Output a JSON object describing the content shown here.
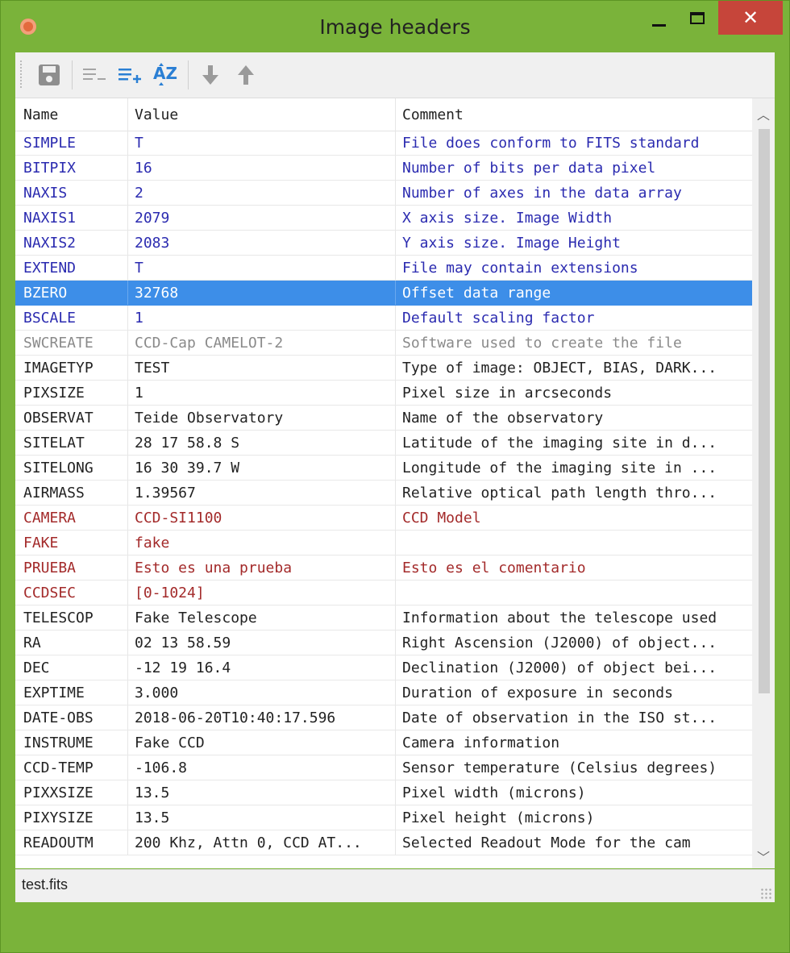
{
  "window": {
    "title": "Image headers",
    "close_glyph": "✕"
  },
  "toolbar": {
    "icons": [
      "save-icon",
      "remove-lines-icon",
      "add-lines-icon",
      "sort-az-icon",
      "arrow-down-icon",
      "arrow-up-icon"
    ],
    "colors": {
      "enabled": "#2a7fd4",
      "disabled": "#9a9a9a"
    }
  },
  "table": {
    "columns": [
      "Name",
      "Value",
      "Comment"
    ],
    "rows": [
      {
        "name": "SIMPLE",
        "value": "T",
        "comment": "File does conform to FITS standard",
        "color": "#2b2bb0"
      },
      {
        "name": "BITPIX",
        "value": "16",
        "comment": "Number of bits per data pixel",
        "color": "#2b2bb0"
      },
      {
        "name": "NAXIS",
        "value": "2",
        "comment": "Number of axes in the data array",
        "color": "#2b2bb0"
      },
      {
        "name": "NAXIS1",
        "value": "2079",
        "comment": "X axis size. Image Width",
        "color": "#2b2bb0"
      },
      {
        "name": "NAXIS2",
        "value": "2083",
        "comment": "Y axis size. Image Height",
        "color": "#2b2bb0"
      },
      {
        "name": "EXTEND",
        "value": "T",
        "comment": "File may contain extensions",
        "color": "#2b2bb0"
      },
      {
        "name": "BZERO",
        "value": "32768",
        "comment": "Offset data range",
        "color": "#ffffff",
        "selected": true
      },
      {
        "name": "BSCALE",
        "value": "1",
        "comment": "Default scaling factor",
        "color": "#2b2bb0"
      },
      {
        "name": "SWCREATE",
        "value": "CCD-Cap CAMELOT-2",
        "comment": "Software used to create the file",
        "color": "#8a8a8a"
      },
      {
        "name": "IMAGETYP",
        "value": "TEST",
        "comment": "Type of image: OBJECT, BIAS, DARK...",
        "color": "#222222"
      },
      {
        "name": "PIXSIZE",
        "value": "1",
        "comment": "Pixel size in arcseconds",
        "color": "#222222"
      },
      {
        "name": "OBSERVAT",
        "value": "Teide Observatory",
        "comment": "Name of the observatory",
        "color": "#222222"
      },
      {
        "name": "SITELAT",
        "value": "28 17 58.8 S",
        "comment": "Latitude of the imaging site in d...",
        "color": "#222222"
      },
      {
        "name": "SITELONG",
        "value": "16 30 39.7 W",
        "comment": "Longitude of the imaging site in ...",
        "color": "#222222"
      },
      {
        "name": "AIRMASS",
        "value": "1.39567",
        "comment": "Relative optical path length thro...",
        "color": "#222222"
      },
      {
        "name": "CAMERA",
        "value": "CCD-SI1100",
        "comment": "CCD Model",
        "color": "#a32a2a"
      },
      {
        "name": "FAKE",
        "value": "fake",
        "comment": "",
        "color": "#a32a2a"
      },
      {
        "name": "PRUEBA",
        "value": "Esto es una prueba",
        "comment": "Esto es el comentario",
        "color": "#a32a2a"
      },
      {
        "name": "CCDSEC",
        "value": "[0-1024]",
        "comment": "",
        "color": "#a32a2a"
      },
      {
        "name": "TELESCOP",
        "value": "Fake Telescope",
        "comment": "Information about the telescope used",
        "color": "#222222"
      },
      {
        "name": "RA",
        "value": "02 13 58.59",
        "comment": "Right Ascension (J2000) of object...",
        "color": "#222222"
      },
      {
        "name": "DEC",
        "value": "-12 19 16.4",
        "comment": "Declination (J2000) of object bei...",
        "color": "#222222"
      },
      {
        "name": "EXPTIME",
        "value": "3.000",
        "comment": "Duration of exposure in seconds",
        "color": "#222222"
      },
      {
        "name": "DATE-OBS",
        "value": "2018-06-20T10:40:17.596",
        "comment": "Date of observation in the ISO st...",
        "color": "#222222"
      },
      {
        "name": "INSTRUME",
        "value": "Fake CCD",
        "comment": "Camera information",
        "color": "#222222"
      },
      {
        "name": "CCD-TEMP",
        "value": "-106.8",
        "comment": "Sensor temperature (Celsius degrees)",
        "color": "#222222"
      },
      {
        "name": "PIXXSIZE",
        "value": "13.5",
        "comment": "Pixel width (microns)",
        "color": "#222222"
      },
      {
        "name": "PIXYSIZE",
        "value": "13.5",
        "comment": "Pixel height (microns)",
        "color": "#222222"
      },
      {
        "name": "READOUTM",
        "value": "200 Khz, Attn 0, CCD AT...",
        "comment": "Selected Readout Mode for the cam",
        "color": "#222222"
      }
    ]
  },
  "statusbar": {
    "text": "test.fits"
  }
}
